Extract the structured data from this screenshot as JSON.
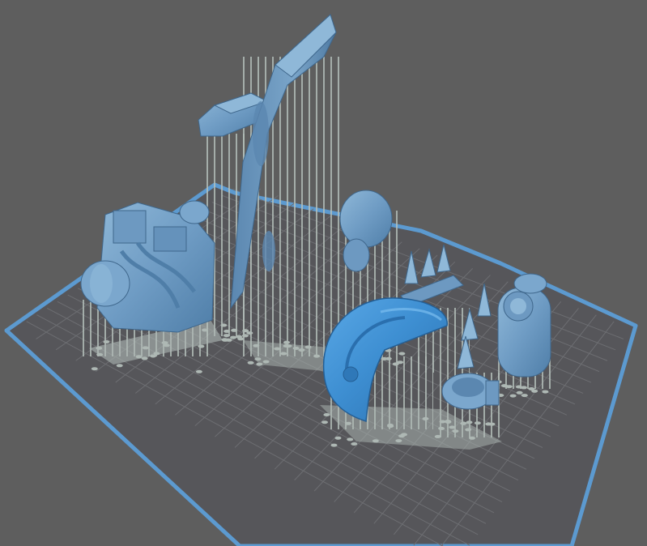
{
  "viewport": {
    "background_color": "#5e5e5e",
    "plate_color": "#56565a",
    "plate_border_color": "#5c9ad0",
    "grid_line_color": "#6d6e72",
    "model_color": "#6f9cc4",
    "model_highlight_color": "#3e8fd2",
    "support_color": "#b6c1bc",
    "support_base_color": "#aeb8b4"
  },
  "scene_objects": [
    {
      "id": "tall-wedge-panel",
      "icon": "3d-model"
    },
    {
      "id": "engine-block",
      "icon": "3d-model"
    },
    {
      "id": "crate-top",
      "icon": "3d-model"
    },
    {
      "id": "ribbed-pod",
      "icon": "3d-model"
    },
    {
      "id": "spike-rail",
      "icon": "3d-model"
    },
    {
      "id": "dome-shell",
      "icon": "3d-model"
    },
    {
      "id": "canister",
      "icon": "3d-model"
    },
    {
      "id": "ring-part",
      "icon": "3d-model"
    }
  ]
}
